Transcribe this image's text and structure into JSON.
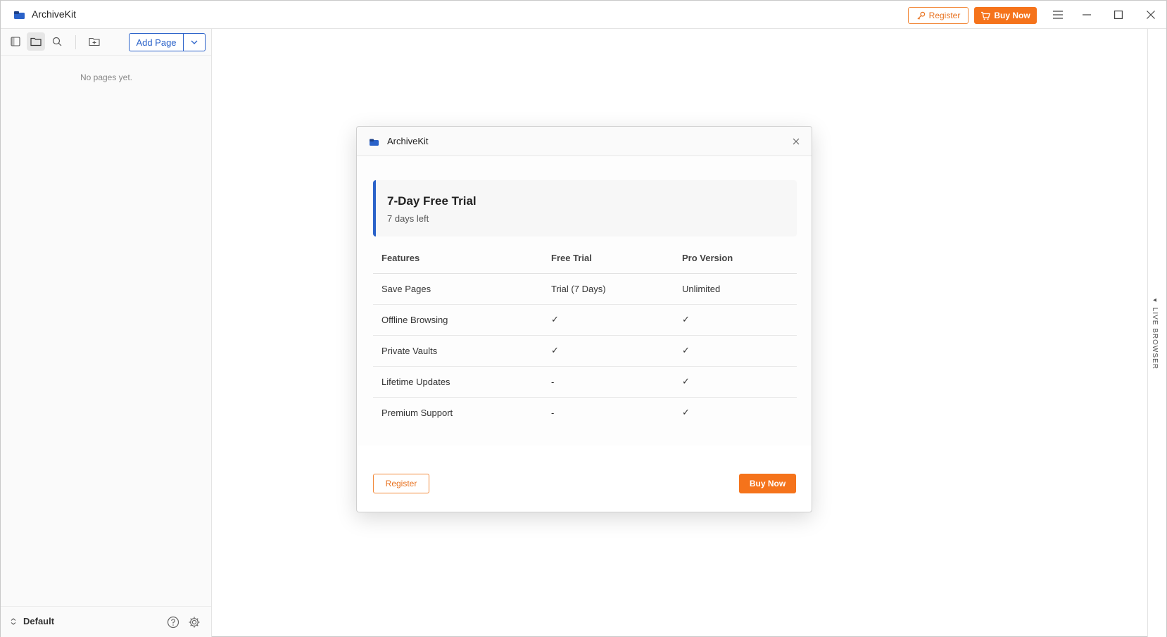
{
  "app": {
    "title": "ArchiveKit",
    "register_label": "Register",
    "buy_now_label": "Buy Now"
  },
  "sidebar": {
    "add_page_label": "Add Page",
    "empty_message": "No pages yet.",
    "workspace_name": "Default"
  },
  "live_browser": {
    "label": "LIVE BROWSER"
  },
  "dialog": {
    "title": "ArchiveKit",
    "trial": {
      "title": "7-Day Free Trial",
      "subtitle": "7 days left"
    },
    "table": {
      "headers": [
        "Features",
        "Free Trial",
        "Pro Version"
      ],
      "rows": [
        [
          "Save Pages",
          "Trial (7 Days)",
          "Unlimited"
        ],
        [
          "Offline Browsing",
          "✓",
          "✓"
        ],
        [
          "Private Vaults",
          "✓",
          "✓"
        ],
        [
          "Lifetime Updates",
          "-",
          "✓"
        ],
        [
          "Premium Support",
          "-",
          "✓"
        ]
      ]
    },
    "register_label": "Register",
    "buy_now_label": "Buy Now"
  },
  "colors": {
    "accent_blue": "#2a62c9",
    "accent_orange": "#f5731b"
  },
  "icons": [
    "archivekit-logo-icon",
    "key-icon",
    "cart-icon",
    "menu-icon",
    "minimize-icon",
    "maximize-icon",
    "close-icon",
    "sidebar-toggle-icon",
    "folder-icon",
    "search-icon",
    "new-folder-icon",
    "chevron-down-icon",
    "chevron-updown-icon",
    "help-icon",
    "gear-icon"
  ]
}
